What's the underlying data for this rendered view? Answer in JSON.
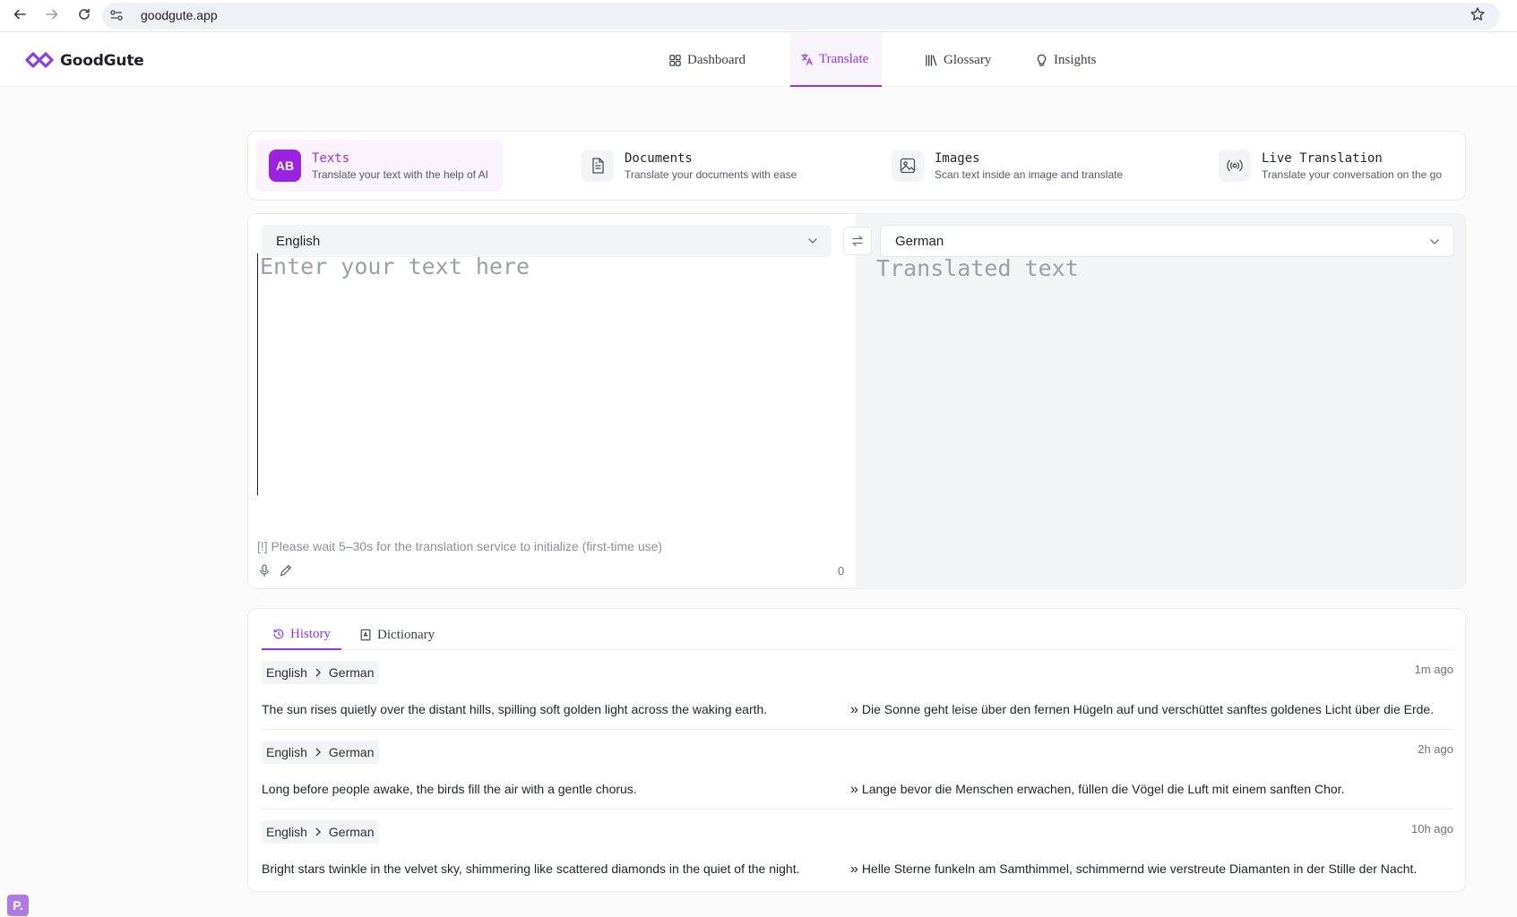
{
  "browser": {
    "url": "goodgute.app"
  },
  "app": {
    "name": "GoodGute",
    "accent_color": "#9333ea"
  },
  "nav": {
    "items": [
      {
        "label": "Dashboard",
        "icon": "grid-icon",
        "active": false
      },
      {
        "label": "Translate",
        "icon": "translate-icon",
        "active": true
      },
      {
        "label": "Glossary",
        "icon": "books-icon",
        "active": false
      },
      {
        "label": "Insights",
        "icon": "lightbulb-icon",
        "active": false
      }
    ]
  },
  "modes": [
    {
      "title": "Texts",
      "desc": "Translate your text with the help of AI",
      "icon": "ab-icon",
      "icon_text": "AB",
      "active": true
    },
    {
      "title": "Documents",
      "desc": "Translate your documents with ease",
      "icon": "document-icon",
      "active": false
    },
    {
      "title": "Images",
      "desc": "Scan text inside an image and translate",
      "icon": "image-icon",
      "active": false
    },
    {
      "title": "Live Translation",
      "desc": "Translate your conversation on the go",
      "icon": "broadcast-icon",
      "active": false
    }
  ],
  "translator": {
    "source_lang": "English",
    "target_lang": "German",
    "input_value": "",
    "input_placeholder": "Enter your text here",
    "output_placeholder": "Translated text",
    "notice": "[!] Please wait 5–30s for the translation service to initialize (first-time use)",
    "char_count": "0"
  },
  "history_tabs": [
    {
      "label": "History",
      "icon": "history-icon",
      "active": true
    },
    {
      "label": "Dictionary",
      "icon": "dictionary-icon",
      "active": false
    }
  ],
  "history": [
    {
      "from": "English",
      "to": "German",
      "time": "1m ago",
      "source": "The sun rises quietly over the distant hills, spilling soft golden light across the waking earth.",
      "marker": "»",
      "translation": "Die Sonne geht leise über den fernen Hügeln auf und verschüttet sanftes goldenes Licht über die Erde."
    },
    {
      "from": "English",
      "to": "German",
      "time": "2h ago",
      "source": "Long before people awake, the birds fill the air with a gentle chorus.",
      "marker": "»",
      "translation": "Lange bevor die Menschen erwachen, füllen die Vögel die Luft mit einem sanften Chor."
    },
    {
      "from": "English",
      "to": "German",
      "time": "10h ago",
      "source": "Bright stars twinkle in the velvet sky, shimmering like scattered diamonds in the quiet of the night.",
      "marker": "»",
      "translation": "Helle Sterne funkeln am Samthimmel, schimmernd wie verstreute Diamanten in der Stille der Nacht."
    }
  ],
  "corner_badge": "P."
}
